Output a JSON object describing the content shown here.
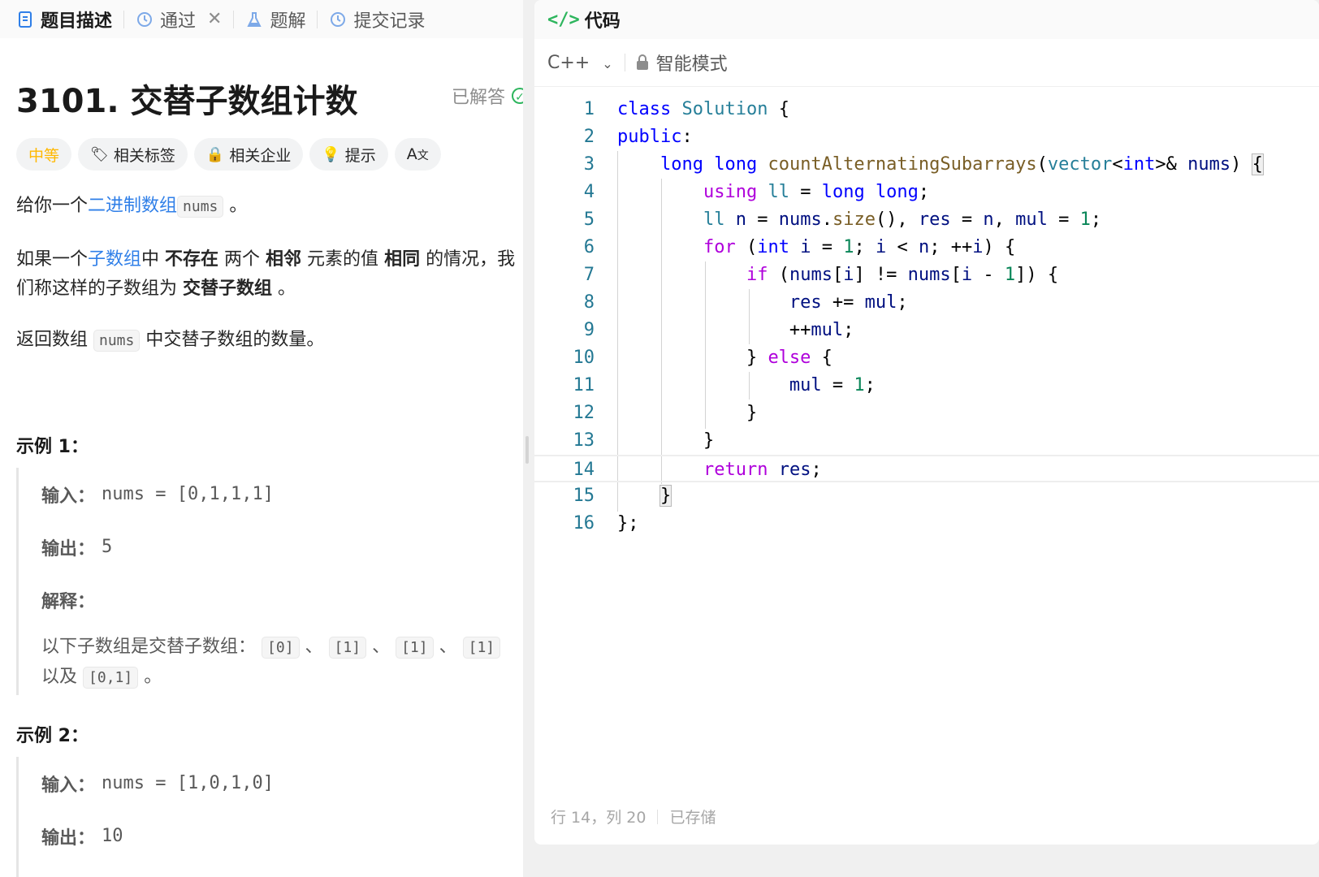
{
  "tabs": [
    {
      "label": "题目描述",
      "active": true,
      "icon": "document-icon"
    },
    {
      "label": "通过",
      "icon": "history-icon"
    },
    {
      "label": "题解",
      "icon": "flask-icon"
    },
    {
      "label": "提交记录",
      "icon": "history-icon"
    }
  ],
  "problem": {
    "title": "3101. 交替子数组计数",
    "status": "已解答",
    "tags": [
      "中等",
      "相关标签",
      "相关企业",
      "提示"
    ],
    "p1": {
      "before": "给你一个",
      "link": "二进制数组",
      "code": "nums",
      "after": " 。"
    },
    "p2": {
      "a": "如果一个",
      "link": "子数组",
      "b": "中 ",
      "c": "不存在",
      "d": " 两个 ",
      "e": "相邻",
      "f": " 元素的值 ",
      "g": "相同",
      "h": " 的情况，我们称这样的子数组为 ",
      "i": "交替子数组",
      "j": " 。"
    },
    "p3": {
      "before": "返回数组 ",
      "code": "nums",
      "after": " 中交替子数组的数量。"
    },
    "examples": [
      {
        "title": "示例 1：",
        "input_label": "输入：",
        "input": "nums = [0,1,1,1]",
        "output_label": "输出：",
        "output": "5",
        "explain_label": "解释：",
        "explain_text": "以下子数组是交替子数组：",
        "items": [
          "[0]",
          "[1]",
          "[1]",
          "[1]"
        ],
        "sep": "、",
        "tail_text": "以及",
        "tail_item": "[0,1]",
        "end": " 。"
      },
      {
        "title": "示例 2：",
        "input_label": "输入：",
        "input": "nums = [1,0,1,0]",
        "output_label": "输出：",
        "output": "10"
      }
    ]
  },
  "editor": {
    "header": "代码",
    "language": "C++",
    "mode": "智能模式",
    "status": {
      "position": "行 14，列 20",
      "saved": "已存储"
    },
    "lines": [
      "1",
      "2",
      "3",
      "4",
      "5",
      "6",
      "7",
      "8",
      "9",
      "10",
      "11",
      "12",
      "13",
      "14",
      "15",
      "16"
    ]
  },
  "colors": {
    "link": "#2f7fe8",
    "difficulty": "#ffb800",
    "solved": "#2db55d"
  }
}
